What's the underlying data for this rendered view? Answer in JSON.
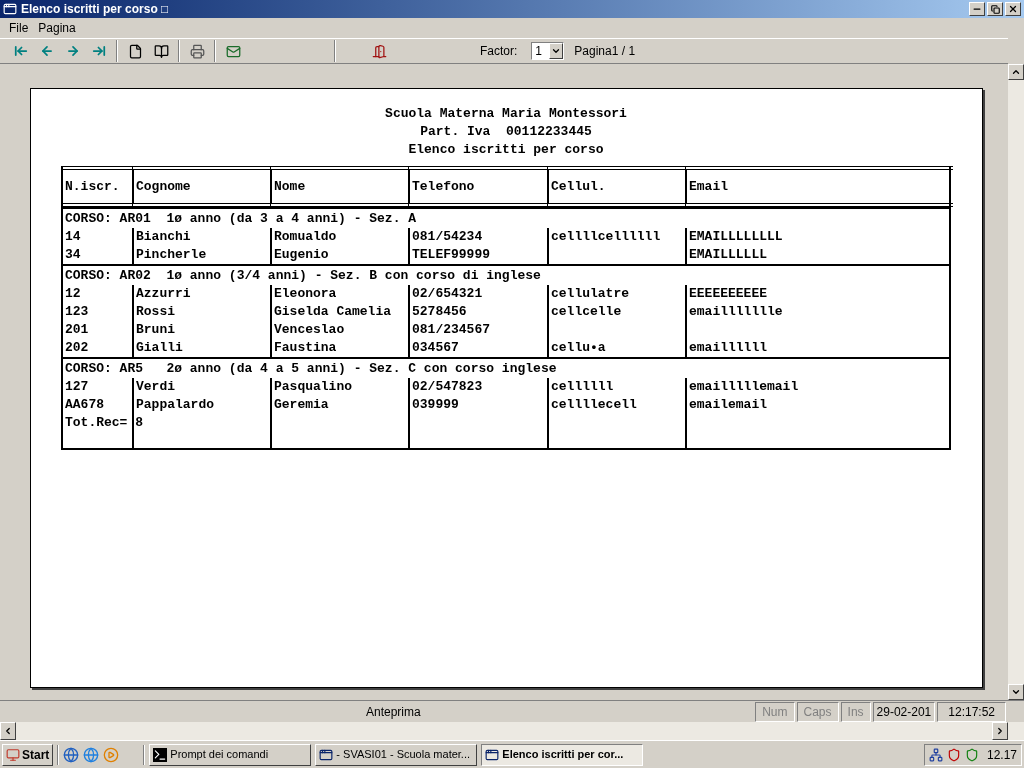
{
  "window": {
    "title": "Elenco iscritti per corso □"
  },
  "menu": [
    "File",
    "Pagina"
  ],
  "toolbar": {
    "factor_label": "Factor:",
    "factor_value": "1",
    "page_info": "Pagina1 / 1"
  },
  "report": {
    "title_lines": [
      "Scuola Materna Maria Montessori",
      "Part. Iva  00112233445",
      "Elenco iscritti per corso"
    ],
    "columns": [
      "N.iscr.",
      "Cognome",
      "Nome",
      "Telefono",
      "Cellul.",
      "Email"
    ],
    "groups": [
      {
        "heading": "CORSO: AR01  1ø anno (da 3 a 4 anni) - Sez. A",
        "rows": [
          [
            "14",
            "Bianchi",
            "Romualdo",
            "081/54234",
            "cellllcellllll",
            "EMAILLLLLLLL"
          ],
          [
            "34",
            "Pincherle",
            "Eugenio",
            "TELEF99999",
            "",
            "EMAILLLLLL"
          ]
        ]
      },
      {
        "heading": "CORSO: AR02  1ø anno (3/4 anni) - Sez. B con corso di inglese",
        "rows": [
          [
            "12",
            "Azzurri",
            "Eleonora",
            "02/654321",
            "cellulatre",
            "EEEEEEEEEE"
          ],
          [
            "123",
            "Rossi",
            "Giselda Camelia",
            "5278456",
            "cellcelle",
            "emaillllllle"
          ],
          [
            "201",
            "Bruni",
            "Venceslao",
            "081/234567",
            "",
            ""
          ],
          [
            "202",
            "Gialli",
            "Faustina",
            "034567",
            "cellu•a",
            "emaillllll"
          ]
        ]
      },
      {
        "heading": "CORSO: AR5   2ø anno (da 4 a 5 anni) - Sez. C con corso inglese",
        "rows": [
          [
            "127",
            "Verdi",
            "Pasqualino",
            "02/547823",
            "cellllll",
            "emailllllemail"
          ],
          [
            "AA678",
            "Pappalardo",
            "Geremia",
            "039999",
            "cellllecell",
            "emailemail"
          ]
        ]
      }
    ],
    "total": "Tot.Rec= 8"
  },
  "status_bar": {
    "message": "Anteprima",
    "indicators": [
      {
        "label": "Num",
        "on": false
      },
      {
        "label": "Caps",
        "on": false
      },
      {
        "label": "Ins",
        "on": false
      }
    ],
    "date": "29-02-201",
    "time": "12:17:52"
  },
  "taskbar": {
    "start": "Start",
    "tasks": [
      {
        "label": "Prompt dei comandi",
        "kind": "console",
        "selected": false
      },
      {
        "label": "- SVASI01 - Scuola mater...",
        "kind": "window",
        "selected": false
      },
      {
        "label": "Elenco iscritti per cor...",
        "kind": "window",
        "selected": true
      }
    ],
    "clock": "12.17"
  }
}
